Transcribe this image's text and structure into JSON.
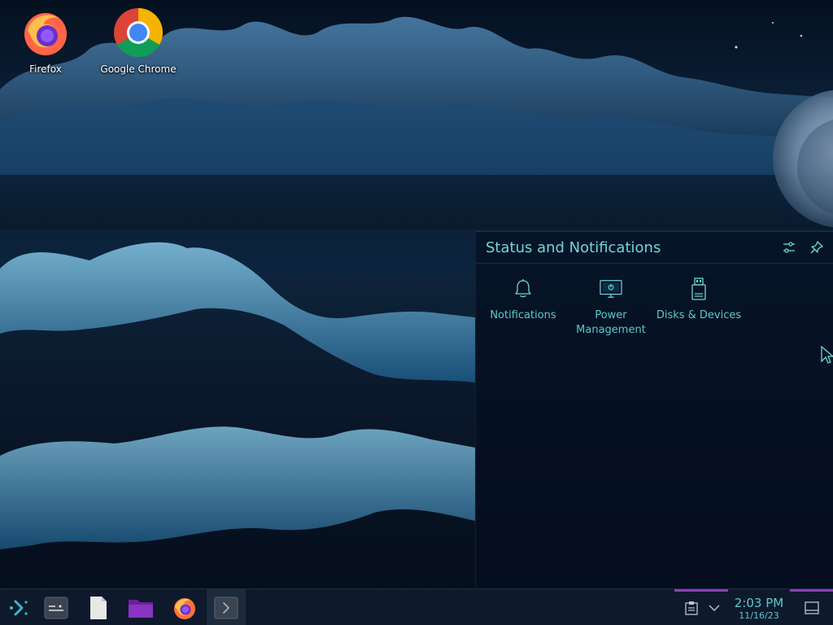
{
  "desktop": {
    "icons": [
      {
        "label": "Firefox",
        "icon": "firefox-icon"
      },
      {
        "label": "Google Chrome",
        "icon": "chrome-icon"
      }
    ]
  },
  "status_panel": {
    "title": "Status and Notifications",
    "header_buttons": [
      "configure-icon",
      "pin-icon"
    ],
    "applets": [
      {
        "label": "Notifications",
        "icon": "bell-icon"
      },
      {
        "label": "Power\nManagement",
        "icon": "monitor-icon"
      },
      {
        "label": "Disks & Devices",
        "icon": "usb-drive-icon"
      }
    ]
  },
  "taskbar": {
    "launcher_icon": "app-launcher-icon",
    "tasks": [
      "terminal-window-icon",
      "document-icon",
      "folder-icon",
      "firefox-icon",
      "terminal-icon"
    ],
    "tray": {
      "icons": [
        "clipboard-icon",
        "chevron-down-icon",
        "show-desktop-icon"
      ],
      "time": "2:03 PM",
      "date": "11/16/23"
    }
  },
  "colors": {
    "accent": "#5cc8cf",
    "panel_bg": "#040e1e",
    "taskbar_bg": "#0e1a2b",
    "tray_highlight": "#8e3fb4"
  }
}
